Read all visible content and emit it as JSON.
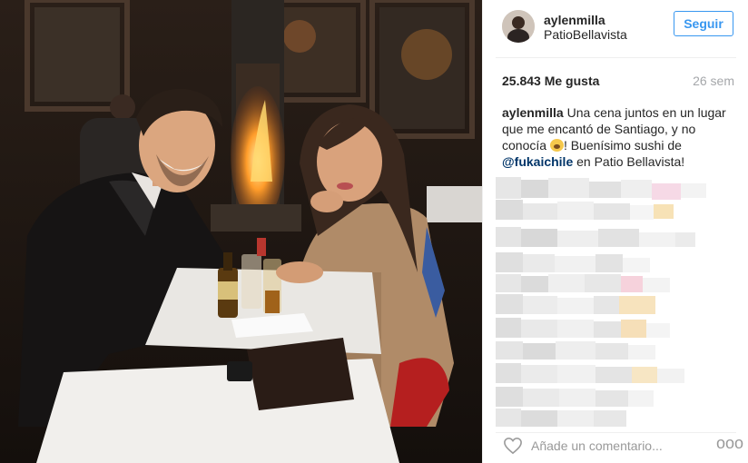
{
  "post": {
    "username": "aylenmilla",
    "location": "PatioBellavista",
    "follow_label": "Seguir",
    "likes": "25.843 Me gusta",
    "time_ago": "26 sem",
    "caption": {
      "username": "aylenmilla",
      "text_part1": "Una cena juntos en un lugar que me encantó de Santiago, y no conocía",
      "text_part2": "! Buenísimo sushi de",
      "mention": "@fukaichile",
      "text_part3": "en Patio Bellavista!"
    },
    "comment_placeholder": "Añade un comentario...",
    "more_label": "ooo"
  },
  "colors": {
    "accent": "#3897f0",
    "mention": "#003569",
    "muted": "#a5a7aa"
  },
  "icons": {
    "like": "heart-outline-icon",
    "options": "three-dots-icon"
  }
}
